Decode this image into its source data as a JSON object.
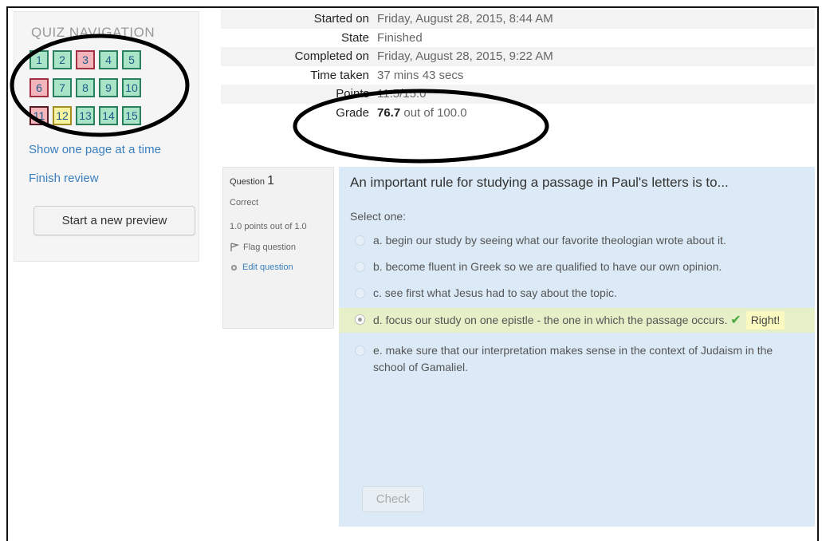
{
  "quiz_navigation": {
    "title": "QUIZ NAVIGATION",
    "questions": [
      {
        "n": "1",
        "status": "correct"
      },
      {
        "n": "2",
        "status": "correct"
      },
      {
        "n": "3",
        "status": "incorrect"
      },
      {
        "n": "4",
        "status": "correct"
      },
      {
        "n": "5",
        "status": "correct"
      },
      {
        "n": "6",
        "status": "incorrect"
      },
      {
        "n": "7",
        "status": "correct"
      },
      {
        "n": "8",
        "status": "correct"
      },
      {
        "n": "9",
        "status": "correct"
      },
      {
        "n": "10",
        "status": "correct"
      },
      {
        "n": "11",
        "status": "incorrect"
      },
      {
        "n": "12",
        "status": "partial"
      },
      {
        "n": "13",
        "status": "correct"
      },
      {
        "n": "14",
        "status": "correct"
      },
      {
        "n": "15",
        "status": "correct"
      }
    ],
    "show_one_page": "Show one page at a time",
    "finish_review": "Finish review",
    "start_preview": "Start a new preview"
  },
  "summary": {
    "rows": [
      {
        "label": "Started on",
        "value": "Friday, August 28, 2015, 8:44 AM"
      },
      {
        "label": "State",
        "value": "Finished"
      },
      {
        "label": "Completed on",
        "value": "Friday, August 28, 2015, 9:22 AM"
      },
      {
        "label": "Time taken",
        "value": "37 mins 43 secs"
      },
      {
        "label": "Points",
        "value": "11.5/15.0"
      }
    ],
    "grade_label": "Grade",
    "grade_value": "76.7",
    "grade_suffix": " out of 100.0"
  },
  "question": {
    "prefix": "Question",
    "number": "1",
    "state": "Correct",
    "points": "1.0 points out of 1.0",
    "flag": "Flag question",
    "edit": "Edit question",
    "text": "An important rule for studying a passage in Paul's letters is to...",
    "prompt": "Select one:",
    "answers": [
      {
        "text": "a. begin our study by seeing what our favorite theologian wrote about it."
      },
      {
        "text": "b. become fluent in Greek so we are qualified to have our own opinion."
      },
      {
        "text": "c. see first what Jesus had to say about the topic."
      },
      {
        "text": "d. focus our study on one epistle - the one in which the passage occurs."
      },
      {
        "text": "e. make sure that our interpretation makes sense in the context of Judaism in the school of Gamaliel."
      }
    ],
    "feedback": "Right!",
    "check": "Check"
  },
  "colors": {
    "correct": "#a9e4c6",
    "incorrect": "#f2b5bc",
    "partial": "#f6f3a0",
    "link": "#3b7fbf",
    "question_bg": "#dbeaf6",
    "correct_answer_bg": "#e6f0c8"
  }
}
